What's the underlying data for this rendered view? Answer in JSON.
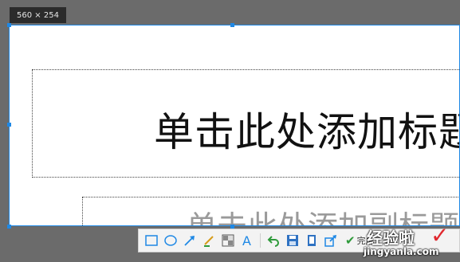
{
  "screenshot_overlay": {
    "size_badge": "560 × 254"
  },
  "slide": {
    "title_placeholder": "单击此处添加标题",
    "subtitle_placeholder": "单击此处添加副标题"
  },
  "toolbar": {
    "tools": [
      {
        "name": "rectangle-tool",
        "icon": "rectangle-icon"
      },
      {
        "name": "ellipse-tool",
        "icon": "ellipse-icon"
      },
      {
        "name": "arrow-tool",
        "icon": "arrow-icon"
      },
      {
        "name": "pen-tool",
        "icon": "pen-icon"
      },
      {
        "name": "mosaic-tool",
        "icon": "mosaic-icon"
      },
      {
        "name": "text-tool",
        "icon": "text-icon"
      },
      {
        "name": "undo-tool",
        "icon": "undo-icon"
      },
      {
        "name": "save-tool",
        "icon": "save-icon"
      },
      {
        "name": "copy-tool",
        "icon": "copy-icon"
      },
      {
        "name": "share-tool",
        "icon": "share-icon"
      }
    ],
    "done_label": "完成",
    "accent_color": "#1e88e5"
  },
  "watermark": {
    "cn": "经验啦",
    "url": "jingyanla.com"
  }
}
